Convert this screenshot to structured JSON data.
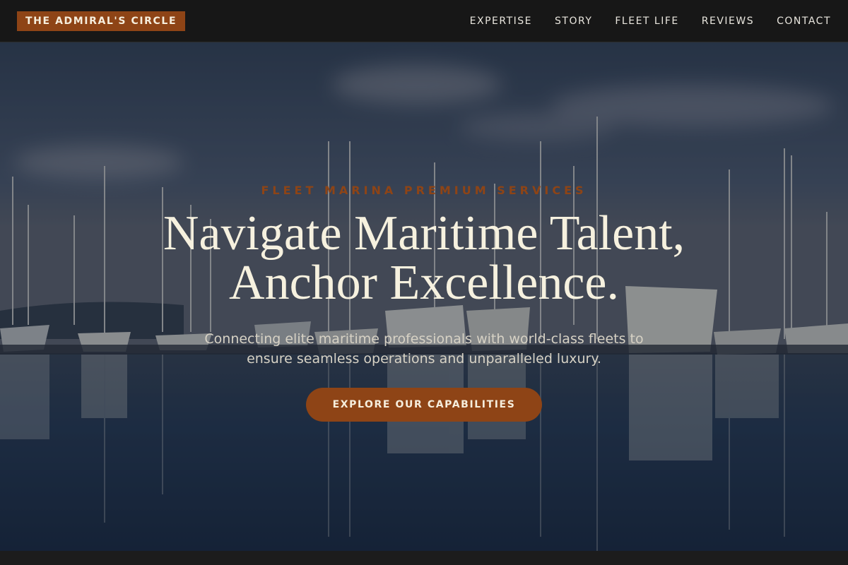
{
  "brand": {
    "name": "THE ADMIRAL'S CIRCLE"
  },
  "nav": {
    "items": [
      {
        "label": "EXPERTISE"
      },
      {
        "label": "STORY"
      },
      {
        "label": "FLEET LIFE"
      },
      {
        "label": "REVIEWS"
      },
      {
        "label": "CONTACT"
      }
    ]
  },
  "hero": {
    "eyebrow": "FLEET MARINA PREMIUM SERVICES",
    "headline_line1": "Navigate Maritime Talent,",
    "headline_line2": "Anchor Excellence.",
    "subtitle_line1": "Connecting elite maritime professionals with world-class fleets to",
    "subtitle_line2": "ensure seamless operations and unparalleled luxury.",
    "cta_label": "EXPLORE OUR CAPABILITIES"
  },
  "colors": {
    "accent": "#8e4416",
    "nav_background": "#171717",
    "headline_text": "#f6f1df"
  }
}
